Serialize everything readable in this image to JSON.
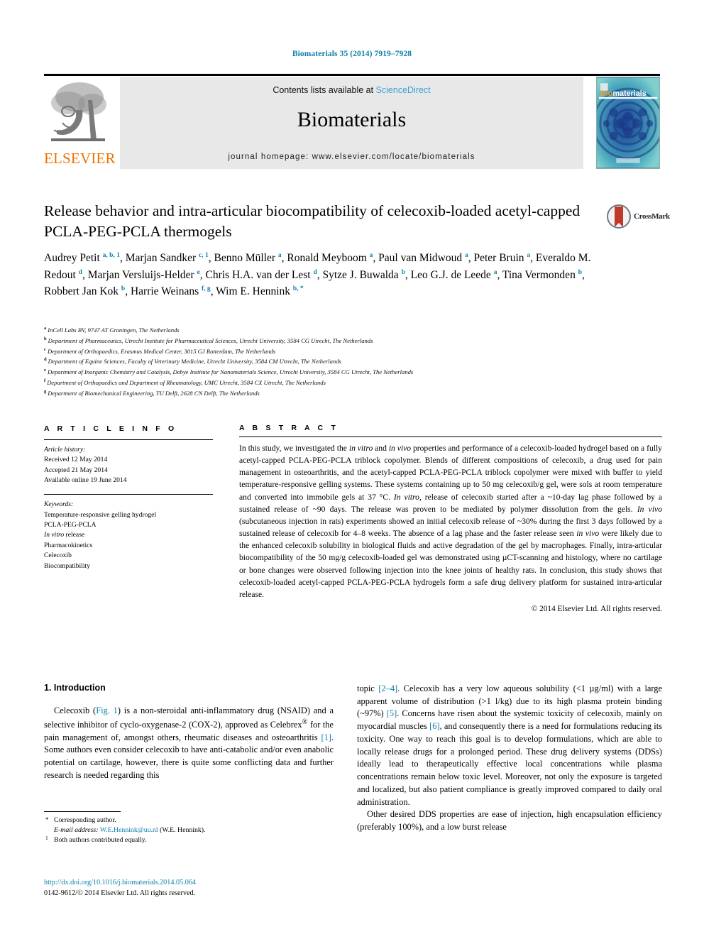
{
  "running_head": "Biomaterials 35 (2014) 7919–7928",
  "masthead": {
    "contents_prefix": "Contents lists available at ",
    "sciencedirect": "ScienceDirect",
    "journal_title": "Biomaterials",
    "journal_homepage": "journal homepage: www.elsevier.com/locate/biomaterials",
    "publisher_logo_text": "ELSEVIER",
    "cover_brand_bio": "Bio",
    "cover_brand_materials": "materials",
    "colors": {
      "link_blue": "#3c9fd6",
      "accent_teal": "#0b7fab",
      "elsevier_orange": "#ee7100",
      "band_grey": "#e8e8e8"
    }
  },
  "crossmark": {
    "label": "CrossMark"
  },
  "title": "Release behavior and intra-articular biocompatibility of celecoxib-loaded acetyl-capped PCLA-PEG-PCLA thermogels",
  "authors_html": "Audrey Petit <sup>a, b, 1</sup>, Marjan Sandker <sup>c, 1</sup>, Benno Müller <sup>a</sup>, Ronald Meyboom <sup>a</sup>, Paul van Midwoud <sup>a</sup>, Peter Bruin <sup>a</sup>, Everaldo M. Redout <sup>d</sup>, Marjan Versluijs-Helder <sup>e</sup>, Chris H.A. van der Lest <sup>d</sup>, Sytze J. Buwalda <sup>b</sup>, Leo G.J. de Leede <sup>a</sup>, Tina Vermonden <sup>b</sup>, Robbert Jan Kok <sup>b</sup>, Harrie Weinans <sup>f, g</sup>, Wim E. Hennink <sup>b, *</sup>",
  "affiliations": [
    {
      "mark": "a",
      "text": "InCell Labs BV, 9747 AT Groningen, The Netherlands"
    },
    {
      "mark": "b",
      "text": "Department of Pharmaceutics, Utrecht Institute for Pharmaceutical Sciences, Utrecht University, 3584 CG Utrecht, The Netherlands"
    },
    {
      "mark": "c",
      "text": "Department of Orthopaedics, Erasmus Medical Center, 3015 GJ Rotterdam, The Netherlands"
    },
    {
      "mark": "d",
      "text": "Department of Equine Sciences, Faculty of Veterinary Medicine, Utrecht University, 3584 CM Utrecht, The Netherlands"
    },
    {
      "mark": "e",
      "text": "Department of Inorganic Chemistry and Catalysis, Debye Institute for Nanomaterials Science, Utrecht University, 3584 CG Utrecht, The Netherlands"
    },
    {
      "mark": "f",
      "text": "Department of Orthopaedics and Department of Rheumatology, UMC Utrecht, 3584 CX Utrecht, The Netherlands"
    },
    {
      "mark": "g",
      "text": "Department of Biomechanical Engineering, TU Delft, 2628 CN Delft, The Netherlands"
    }
  ],
  "article_info": {
    "heading": "A R T I C L E   I N F O",
    "history_label": "Article history:",
    "history": [
      "Received 12 May 2014",
      "Accepted 21 May 2014",
      "Available online 19 June 2014"
    ],
    "keywords_label": "Keywords:",
    "keywords": [
      "Temperature-responsive gelling hydrogel",
      "PCLA-PEG-PCLA",
      "In vitro release",
      "Pharmacokinetics",
      "Celecoxib",
      "Biocompatibility"
    ]
  },
  "abstract": {
    "heading": "A B S T R A C T",
    "body_html": "In this study, we investigated the <i>in vitro</i> and <i>in vivo</i> properties and performance of a celecoxib-loaded hydrogel based on a fully acetyl-capped PCLA-PEG-PCLA triblock copolymer. Blends of different compositions of celecoxib, a drug used for pain management in osteoarthritis, and the acetyl-capped PCLA-PEG-PCLA triblock copolymer were mixed with buffer to yield temperature-responsive gelling systems. These systems containing up to 50 mg celecoxib/g gel, were sols at room temperature and converted into immobile gels at 37 °C. <i>In vitro</i>, release of celecoxib started after a ~10-day lag phase followed by a sustained release of ~90 days. The release was proven to be mediated by polymer dissolution from the gels. <i>In vivo</i> (subcutaneous injection in rats) experiments showed an initial celecoxib release of ~30% during the first 3 days followed by a sustained release of celecoxib for 4–8 weeks. The absence of a lag phase and the faster release seen <i>in vivo</i> were likely due to the enhanced celecoxib solubility in biological fluids and active degradation of the gel by macrophages. Finally, intra-articular biocompatibility of the 50 mg/g celecoxib-loaded gel was demonstrated using µCT-scanning and histology, where no cartilage or bone changes were observed following injection into the knee joints of healthy rats. In conclusion, this study shows that celecoxib-loaded acetyl-capped PCLA-PEG-PCLA hydrogels form a safe drug delivery platform for sustained intra-articular release.",
    "copyright": "© 2014 Elsevier Ltd. All rights reserved."
  },
  "introduction": {
    "heading": "1.  Introduction",
    "para1_html": "Celecoxib (<span class=\"ref\">Fig. 1</span>) is a non-steroidal anti-inflammatory drug (NSAID) and a selective inhibitor of cyclo-oxygenase-2 (COX-2), approved as Celebrex<sup>®</sup> for the pain management of, amongst others, rheumatic diseases and osteoarthritis <span class=\"ref\">[1]</span>. Some authors even consider celecoxib to have anti-catabolic and/or even anabolic potential on cartilage, however, there is quite some conflicting data and further research is needed regarding this",
    "para1_cont_html": "topic <span class=\"ref\">[2–4]</span>. Celecoxib has a very low aqueous solubility (&lt;1 µg/ml) with a large apparent volume of distribution (&gt;1 l/kg) due to its high plasma protein binding (~97%) <span class=\"ref\">[5]</span>. Concerns have risen about the systemic toxicity of celecoxib, mainly on myocardial muscles <span class=\"ref\">[6]</span>, and consequently there is a need for formulations reducing its toxicity. One way to reach this goal is to develop formulations, which are able to locally release drugs for a prolonged period. These drug delivery systems (DDSs) ideally lead to therapeutically effective local concentrations while plasma concentrations remain below toxic level. Moreover, not only the exposure is targeted and localized, but also patient compliance is greatly improved compared to daily oral administration.",
    "para2_html": "Other desired DDS properties are ease of injection, high encapsulation efficiency (preferably 100%), and a low burst release"
  },
  "footnotes": {
    "corresponding_mark": "*",
    "corresponding_text": "Corresponding author.",
    "email_label": "E-mail address:",
    "email": "W.E.Hennink@uu.nl",
    "email_owner": "(W.E. Hennink).",
    "equal_mark": "1",
    "equal_text": "Both authors contributed equally."
  },
  "imprint": {
    "doi": "http://dx.doi.org/10.1016/j.biomaterials.2014.05.064",
    "issn_line": "0142-9612/© 2014 Elsevier Ltd. All rights reserved."
  }
}
